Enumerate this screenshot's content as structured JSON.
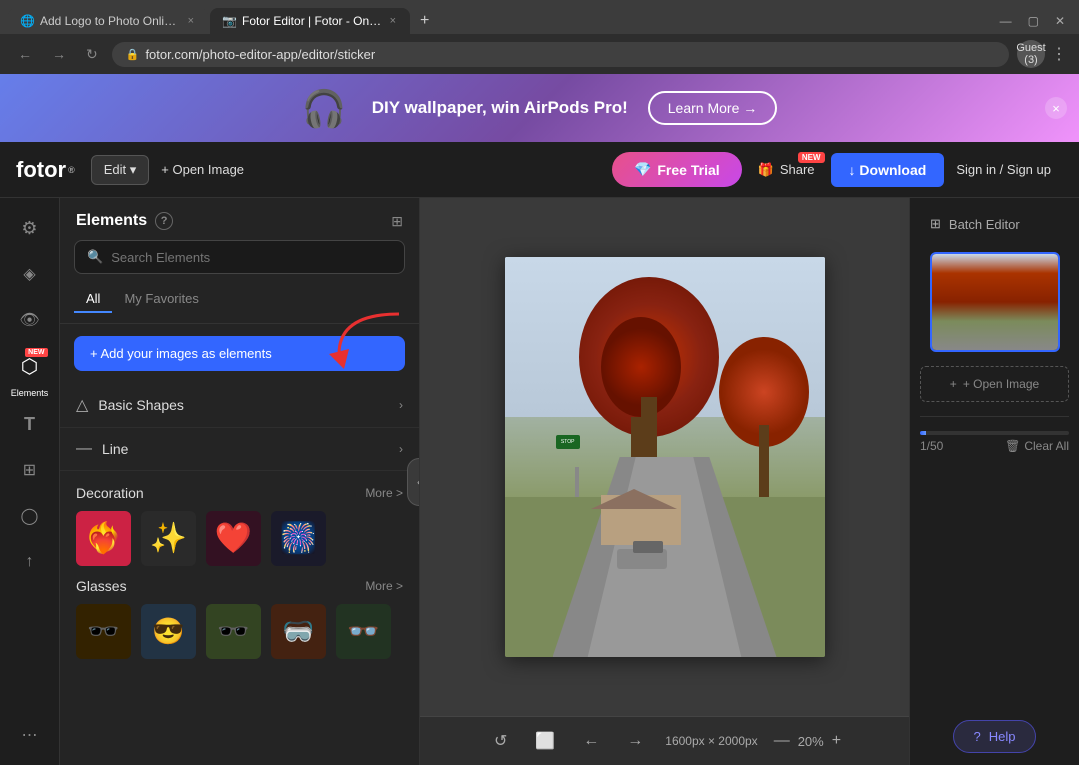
{
  "browser": {
    "tabs": [
      {
        "id": "tab1",
        "favicon": "🌐",
        "title": "Add Logo to Photo Online for...",
        "active": false
      },
      {
        "id": "tab2",
        "favicon": "📷",
        "title": "Fotor Editor | Fotor - Online...",
        "active": true
      }
    ],
    "new_tab_label": "+",
    "address": "fotor.com/photo-editor-app/editor/sticker",
    "profile_label": "Guest (3)"
  },
  "promo": {
    "text": "DIY wallpaper, win AirPods Pro!",
    "cta_label": "Learn More →",
    "close_label": "×"
  },
  "header": {
    "logo": "fotor",
    "logo_sup": "®",
    "edit_label": "Edit ▾",
    "open_image_label": "+ Open Image",
    "free_trial_label": "Free Trial",
    "share_label": "Share",
    "share_badge": "NEW",
    "download_label": "↓ Download",
    "signin_label": "Sign in / Sign up"
  },
  "left_toolbar": {
    "tools": [
      {
        "id": "filters",
        "icon": "⚙",
        "label": ""
      },
      {
        "id": "adjust",
        "icon": "◈",
        "label": ""
      },
      {
        "id": "eye",
        "icon": "👁",
        "label": ""
      },
      {
        "id": "stickers",
        "icon": "⬡",
        "label": "Elements",
        "active": true,
        "new": true
      },
      {
        "id": "text",
        "icon": "T",
        "label": ""
      },
      {
        "id": "layers",
        "icon": "⊞",
        "label": ""
      },
      {
        "id": "effects",
        "icon": "◯",
        "label": ""
      },
      {
        "id": "upload",
        "icon": "↑",
        "label": ""
      },
      {
        "id": "more",
        "icon": "⋯",
        "label": ""
      }
    ]
  },
  "elements_panel": {
    "title": "Elements",
    "help_icon": "?",
    "grid_icon": "⊞",
    "search_placeholder": "Search Elements",
    "tabs": [
      {
        "id": "all",
        "label": "All",
        "active": true
      },
      {
        "id": "favorites",
        "label": "My Favorites",
        "active": false
      }
    ],
    "add_btn_label": "+ Add your images as elements",
    "sections": [
      {
        "id": "basic-shapes",
        "icon": "△",
        "label": "Basic Shapes"
      },
      {
        "id": "line",
        "icon": "—",
        "label": "Line"
      }
    ],
    "decoration": {
      "title": "Decoration",
      "more_label": "More >",
      "items": [
        "❤️‍🔥",
        "✨",
        "❤️",
        "🎆"
      ]
    },
    "glasses": {
      "title": "Glasses",
      "more_label": "More >",
      "items": [
        "🕶️",
        "😎",
        "🕶️",
        "🥽",
        "👓"
      ]
    }
  },
  "canvas": {
    "dimensions": "1600px × 2000px",
    "zoom": "20%",
    "tools": [
      "↺",
      "⬜",
      "←",
      "→"
    ]
  },
  "right_panel": {
    "batch_editor_label": "Batch Editor",
    "open_image_label": "+ Open Image",
    "progress": "1/50",
    "clear_all_label": "Clear All",
    "help_label": "Help"
  }
}
